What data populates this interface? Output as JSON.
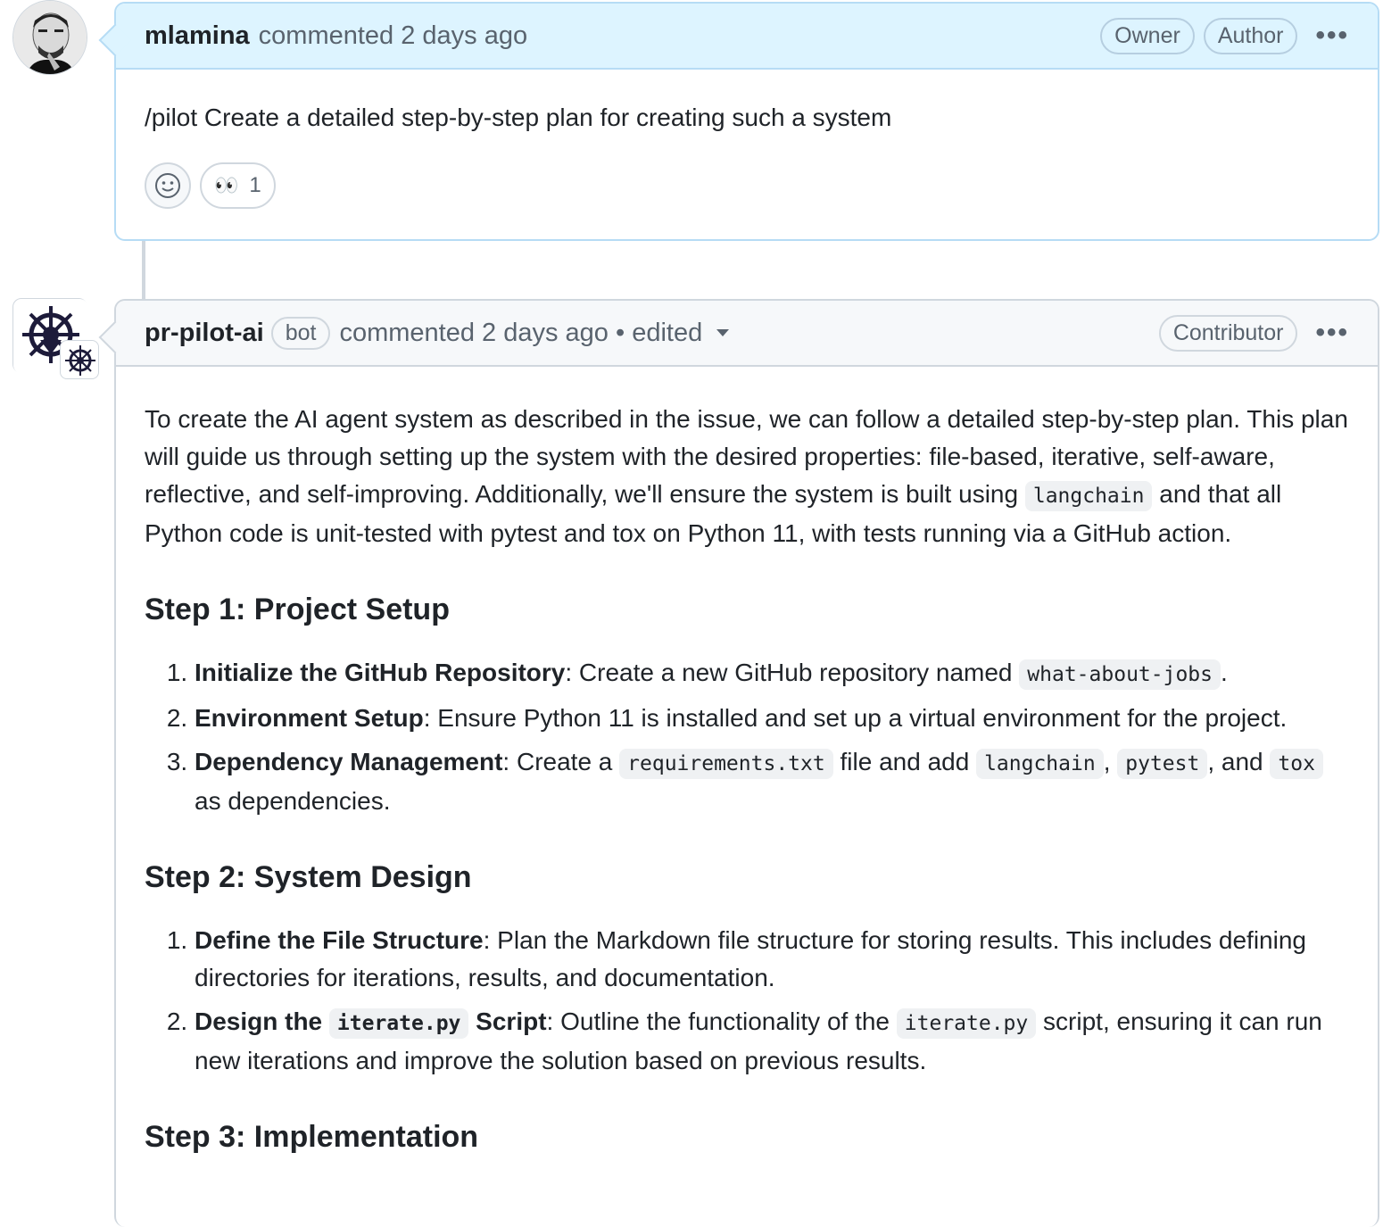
{
  "comment1": {
    "author": "mlamina",
    "meta": "commented 2 days ago",
    "badges": [
      "Owner",
      "Author"
    ],
    "more": "•••",
    "body": "/pilot Create a detailed step-by-step plan for creating such a system",
    "reactions": [
      {
        "icon": "smiley-icon",
        "label": ""
      },
      {
        "icon": "eyes-emoji",
        "emoji": "👀",
        "count": "1"
      }
    ]
  },
  "comment2": {
    "author": "pr-pilot-ai",
    "bot_label": "bot",
    "meta": "commented 2 days ago • edited",
    "badges": [
      "Contributor"
    ],
    "more": "•••",
    "intro": {
      "p1": "To create the AI agent system as described in the issue, we can follow a detailed step-by-step plan. This plan will guide us through setting up the system with the desired properties: file-based, iterative, self-aware, reflective, and self-improving. Additionally, we'll ensure the system is built using ",
      "code1": "langchain",
      "p2": " and that all Python code is unit-tested with pytest and tox on Python 11, with tests running via a GitHub action."
    },
    "step1": {
      "heading": "Step 1: Project Setup",
      "items": [
        {
          "bold": "Initialize the GitHub Repository",
          "text": ": Create a new GitHub repository named ",
          "code": "what-about-jobs",
          "tail": "."
        },
        {
          "bold": "Environment Setup",
          "text": ": Ensure Python 11 is installed and set up a virtual environment for the project."
        },
        {
          "bold": "Dependency Management",
          "text": ": Create a ",
          "code": "requirements.txt",
          "mid": " file and add ",
          "code2": "langchain",
          "sep1": ", ",
          "code3": "pytest",
          "sep2": ", and ",
          "code4": "tox",
          "tail": " as dependencies."
        }
      ]
    },
    "step2": {
      "heading": "Step 2: System Design",
      "items": [
        {
          "bold": "Define the File Structure",
          "text": ": Plan the Markdown file structure for storing results. This includes defining directories for iterations, results, and documentation."
        },
        {
          "bold_a": "Design the ",
          "bold_code": "iterate.py",
          "bold_b": " Script",
          "text": ": Outline the functionality of the ",
          "code": "iterate.py",
          "tail": " script, ensuring it can run new iterations and improve the solution based on previous results."
        }
      ]
    },
    "step3": {
      "heading": "Step 3: Implementation"
    }
  }
}
